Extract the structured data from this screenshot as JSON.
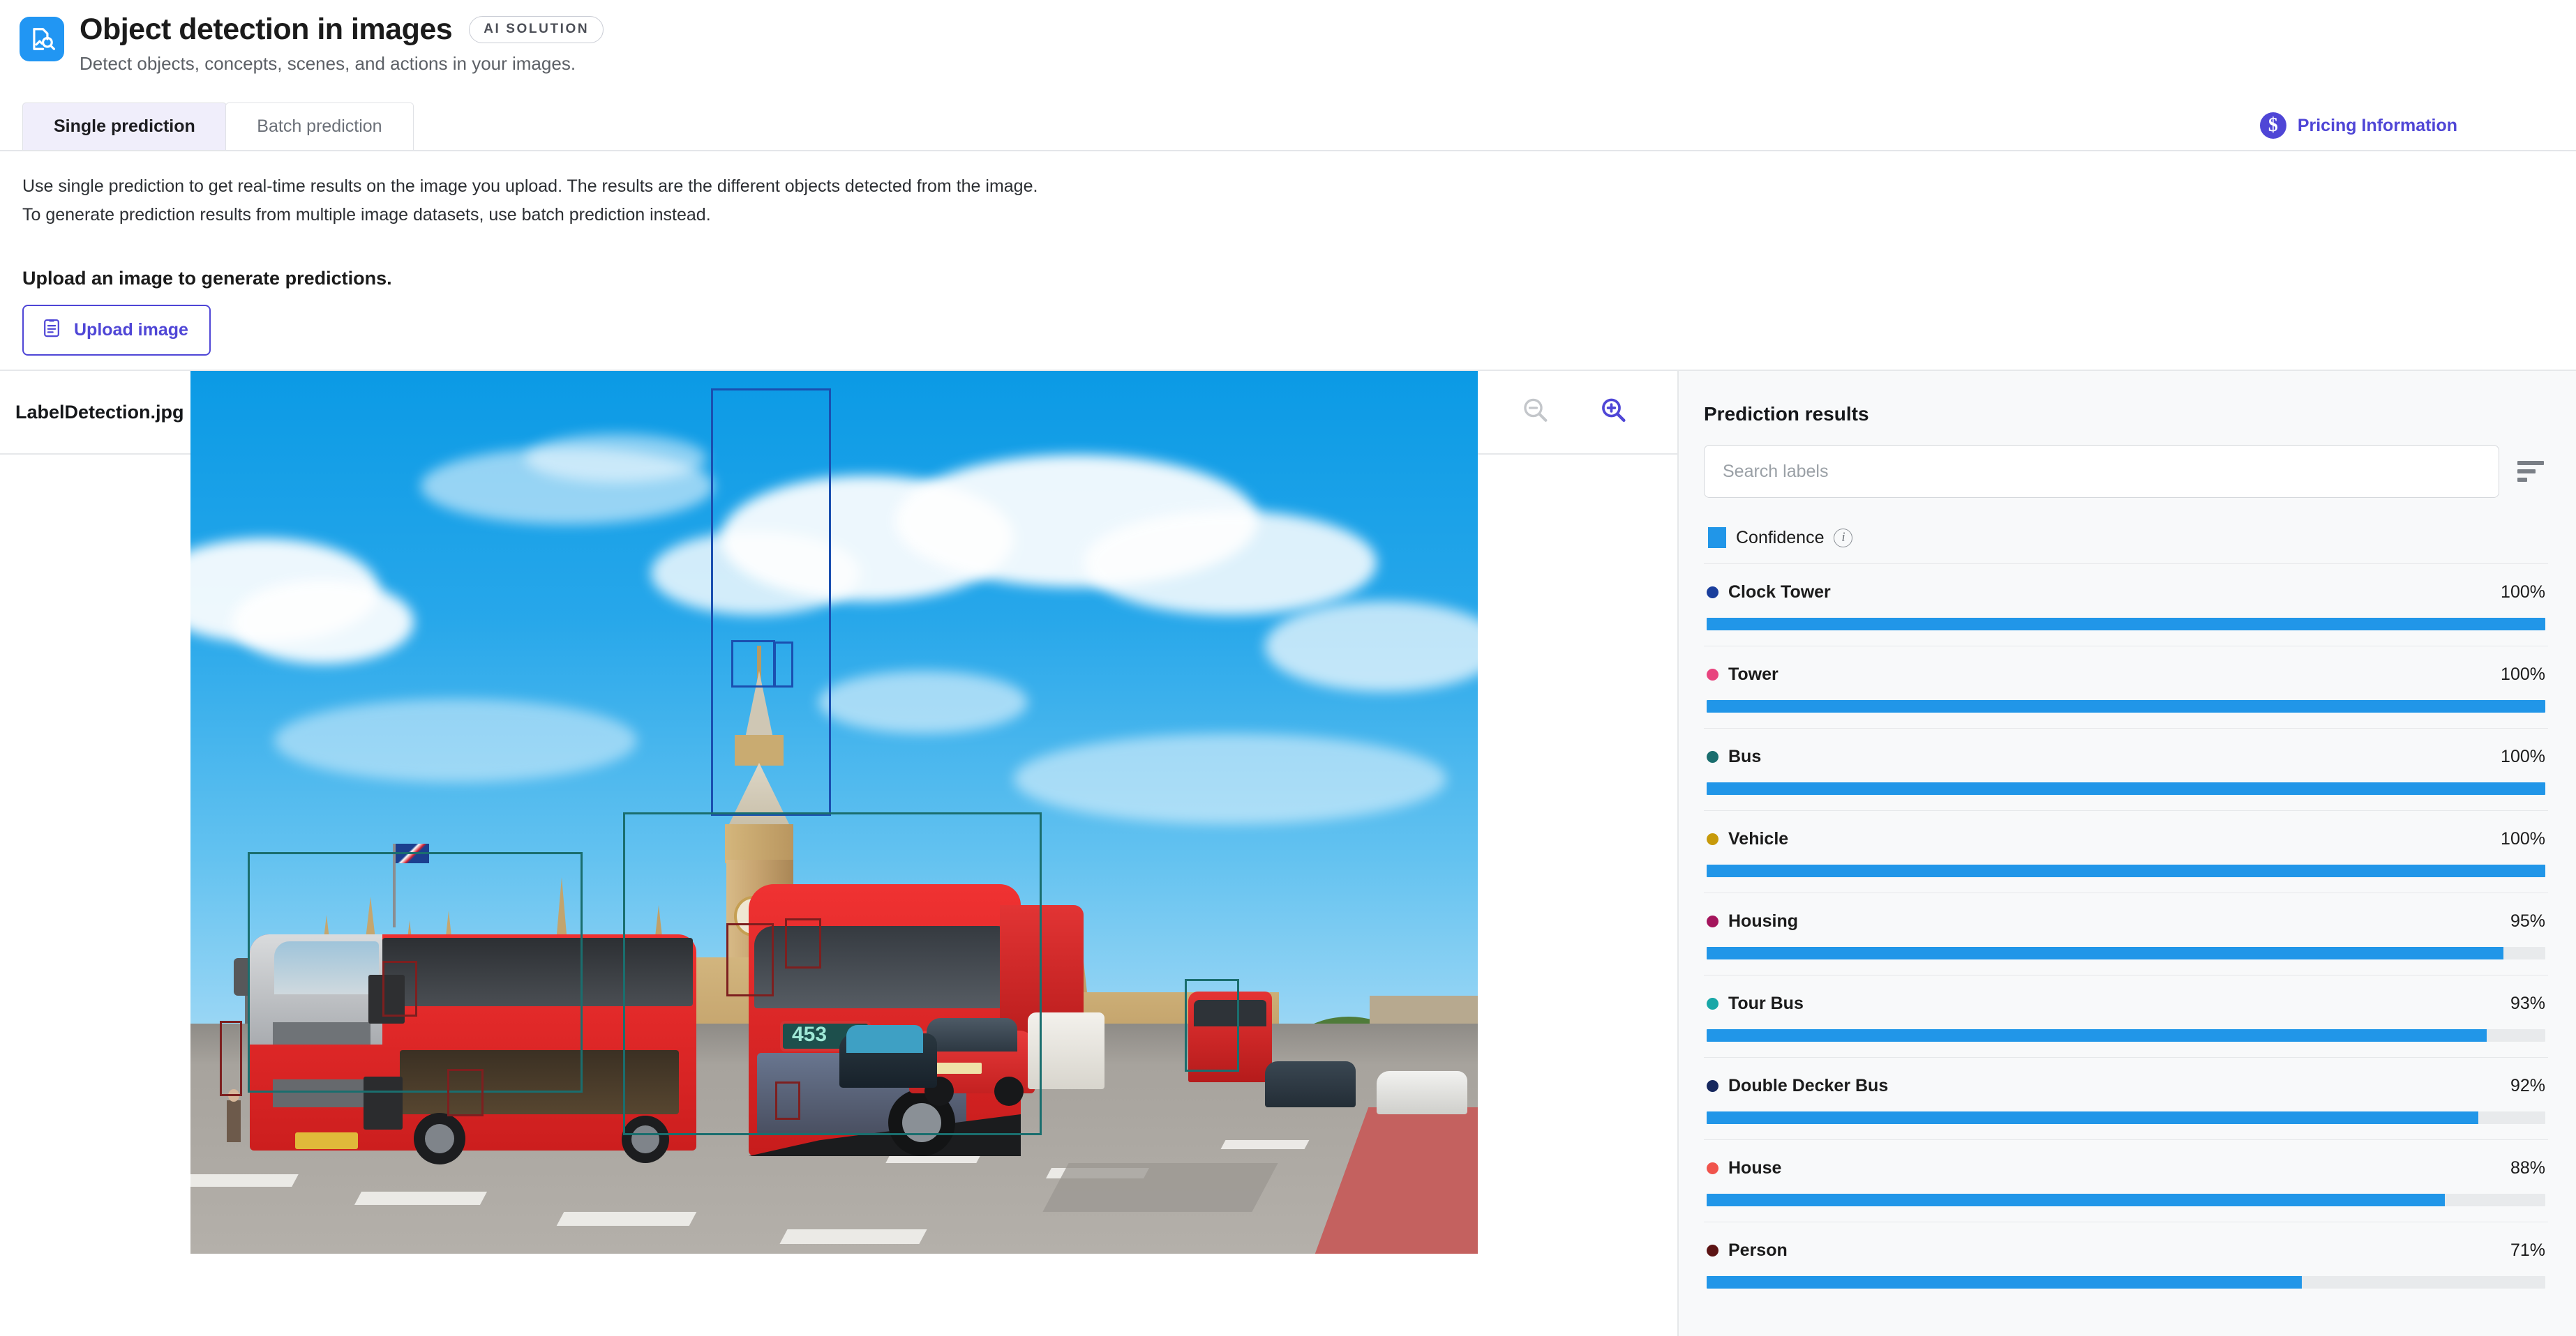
{
  "header": {
    "app_icon": "image-search-icon",
    "title": "Object detection in images",
    "badge": "AI SOLUTION",
    "subtitle": "Detect objects, concepts, scenes, and actions in your images."
  },
  "tabs": [
    {
      "label": "Single prediction",
      "active": true
    },
    {
      "label": "Batch prediction",
      "active": false
    }
  ],
  "pricing": {
    "label": "Pricing Information",
    "icon": "dollar-circle-icon",
    "color": "#4f46d6"
  },
  "intro": {
    "line1": "Use single prediction to get real-time results on the image you upload. The results are the different objects detected from the image.",
    "line2": "To generate prediction results from multiple image datasets, use batch prediction instead."
  },
  "upload": {
    "heading": "Upload an image to generate predictions.",
    "button_label": "Upload image",
    "button_icon": "document-upload-icon"
  },
  "viewer": {
    "file_name": "LabelDetection.jpg",
    "zoom_out_icon": "zoom-out-icon",
    "zoom_in_icon": "zoom-in-icon",
    "zoom_out_enabled": false,
    "zoom_in_enabled": true,
    "image_alt": "Red double decker buses in front of Big Ben and the Houses of Parliament, London",
    "bus_destination_sign": "453"
  },
  "results": {
    "title": "Prediction results",
    "search_placeholder": "Search labels",
    "search_value": "",
    "sort_icon": "sort-icon",
    "legend": {
      "label": "Confidence",
      "color": "#2196e8",
      "info_icon": "info-icon"
    }
  },
  "chart_data": {
    "type": "bar",
    "title": "Prediction results",
    "xlabel": "",
    "ylabel": "Confidence",
    "ylim": [
      0,
      100
    ],
    "unit": "%",
    "bar_color": "#2196e8",
    "track_color": "#e8eaec",
    "categories": [
      "Clock Tower",
      "Tower",
      "Bus",
      "Vehicle",
      "Housing",
      "Tour Bus",
      "Double Decker Bus",
      "House",
      "Person"
    ],
    "values": [
      100,
      100,
      100,
      100,
      95,
      93,
      92,
      88,
      71
    ],
    "value_labels": [
      "100%",
      "100%",
      "100%",
      "100%",
      "95%",
      "93%",
      "92%",
      "88%",
      "71%"
    ],
    "dot_colors": [
      "#1a3e9c",
      "#e8457f",
      "#1a6e6e",
      "#c79a0a",
      "#a4155c",
      "#18a7a7",
      "#16285e",
      "#f0544c",
      "#5c1414"
    ]
  },
  "photo_boxes": [
    {
      "label": "Clock Tower",
      "color": "#1a4fb0"
    },
    {
      "label": "Tower",
      "color": "#1a4fb0"
    },
    {
      "label": "Bus",
      "color": "#1a6e6e"
    },
    {
      "label": "Person",
      "color": "#7d1f1f"
    }
  ]
}
